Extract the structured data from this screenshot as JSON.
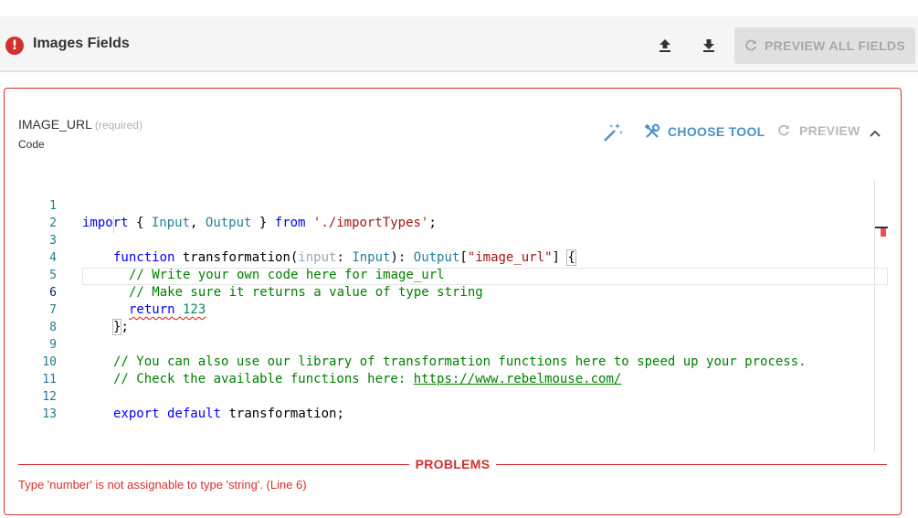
{
  "header": {
    "title": "Images Fields",
    "error_icon_glyph": "!",
    "upload_icon": "upload-icon",
    "download_icon": "download-icon",
    "preview_all_label": "PREVIEW ALL FIELDS"
  },
  "field": {
    "name": "IMAGE_URL",
    "required_label": "(required)",
    "type_label": "Code",
    "choose_tool_label": "CHOOSE TOOL",
    "preview_label": "PREVIEW"
  },
  "editor": {
    "line_numbers": [
      "1",
      "2",
      "3",
      "4",
      "5",
      "6",
      "7",
      "8",
      "9",
      "10",
      "11",
      "12",
      "13"
    ],
    "active_line": "6",
    "lines": {
      "l1": {
        "kw1": "import",
        "p1": " { ",
        "ty1": "Input",
        "p2": ", ",
        "ty2": "Output",
        "p3": " } ",
        "kw2": "from",
        "p4": " ",
        "str1": "'./importTypes'",
        "p5": ";"
      },
      "l3": {
        "kw1": "function",
        "p1": " transformation(",
        "param": "input",
        "p2": ": ",
        "ty1": "Input",
        "p3": "): ",
        "ty2": "Output",
        "p4": "[",
        "str1": "\"image_url\"",
        "p5": "] ",
        "br": "{"
      },
      "l4": {
        "cm": "// Write your own code here for image_url"
      },
      "l5": {
        "cm": "// Make sure it returns a value of type string"
      },
      "l6": {
        "err": "return 123"
      },
      "l7": {
        "br": "}",
        "p1": ";"
      },
      "l9": {
        "cm": "// You can also use our library of transformation functions here to speed up your process."
      },
      "l10": {
        "cm": "// Check the available functions here: ",
        "link": "https://www.rebelmouse.com/"
      },
      "l12": {
        "kw1": "export",
        "p1": " ",
        "kw2": "default",
        "p2": " transformation;"
      }
    }
  },
  "problems": {
    "label": "PROBLEMS",
    "message": "Type 'number' is not assignable to type 'string'.  (Line 6)"
  },
  "colors": {
    "error": "#d32f2f",
    "accent": "#4a90c8",
    "disabled": "#a8a8a8"
  }
}
